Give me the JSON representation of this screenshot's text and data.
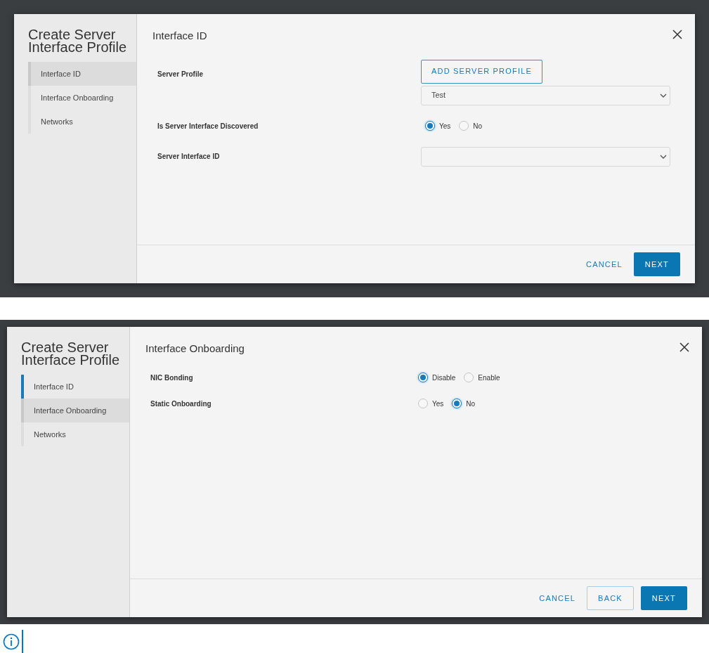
{
  "dialogs": [
    {
      "title": "Create Server Interface Profile",
      "steps": [
        {
          "label": "Interface ID",
          "selected": true,
          "completed": false
        },
        {
          "label": "Interface Onboarding",
          "selected": false,
          "completed": false
        },
        {
          "label": "Networks",
          "selected": false,
          "completed": false
        }
      ],
      "section_title": "Interface ID",
      "fields": [
        {
          "kind": "select",
          "label": "Server Profile",
          "button": "ADD SERVER PROFILE",
          "value": "Test"
        },
        {
          "kind": "radio",
          "label": "Is Server Interface Discovered",
          "options": [
            {
              "label": "Yes",
              "selected": true
            },
            {
              "label": "No",
              "selected": false
            }
          ]
        },
        {
          "kind": "select",
          "label": "Server Interface ID"
        }
      ],
      "buttons": [
        {
          "label": "CANCEL",
          "kind": "text"
        },
        {
          "label": "NEXT",
          "kind": "primary"
        }
      ]
    },
    {
      "title": "Create Server Interface Profile",
      "steps": [
        {
          "label": "Interface ID",
          "selected": false,
          "completed": true
        },
        {
          "label": "Interface Onboarding",
          "selected": true,
          "completed": false
        },
        {
          "label": "Networks",
          "selected": false,
          "completed": false
        }
      ],
      "section_title": "Interface Onboarding",
      "fields": [
        {
          "kind": "radio",
          "label": "NIC Bonding",
          "options": [
            {
              "label": "Disable",
              "selected": true
            },
            {
              "label": "Enable",
              "selected": false
            }
          ]
        },
        {
          "kind": "radio",
          "label": "Static Onboarding",
          "options": [
            {
              "label": "Yes",
              "selected": false
            },
            {
              "label": "No",
              "selected": true
            }
          ]
        }
      ],
      "buttons": [
        {
          "label": "CANCEL",
          "kind": "text"
        },
        {
          "label": "BACK",
          "kind": "outline"
        },
        {
          "label": "NEXT",
          "kind": "primary"
        }
      ]
    }
  ]
}
